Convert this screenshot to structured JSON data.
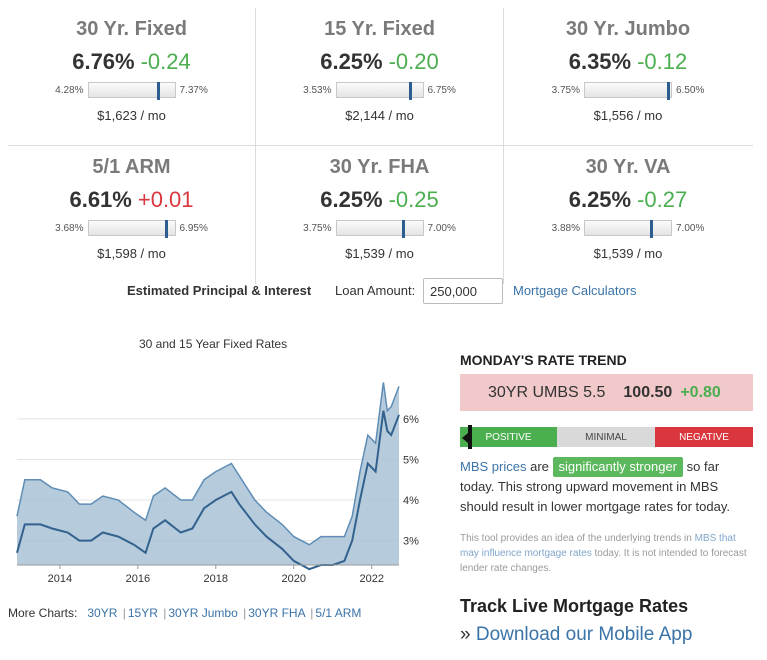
{
  "products": [
    {
      "name": "30 Yr. Fixed",
      "rate": "6.76%",
      "change": "-0.24",
      "dir": "down",
      "low": "4.28%",
      "high": "7.37%",
      "position": 0.8,
      "payment": "$1,623 / mo"
    },
    {
      "name": "15 Yr. Fixed",
      "rate": "6.25%",
      "change": "-0.20",
      "dir": "down",
      "low": "3.53%",
      "high": "6.75%",
      "position": 0.85,
      "payment": "$2,144 / mo"
    },
    {
      "name": "30 Yr. Jumbo",
      "rate": "6.35%",
      "change": "-0.12",
      "dir": "down",
      "low": "3.75%",
      "high": "6.50%",
      "position": 0.97,
      "payment": "$1,556 / mo"
    },
    {
      "name": "5/1 ARM",
      "rate": "6.61%",
      "change": "+0.01",
      "dir": "up",
      "low": "3.68%",
      "high": "6.95%",
      "position": 0.9,
      "payment": "$1,598 / mo"
    },
    {
      "name": "30 Yr. FHA",
      "rate": "6.25%",
      "change": "-0.25",
      "dir": "down",
      "low": "3.75%",
      "high": "7.00%",
      "position": 0.77,
      "payment": "$1,539 / mo"
    },
    {
      "name": "30 Yr. VA",
      "rate": "6.25%",
      "change": "-0.27",
      "dir": "down",
      "low": "3.88%",
      "high": "7.00%",
      "position": 0.76,
      "payment": "$1,539 / mo"
    }
  ],
  "calculator": {
    "label": "Estimated Principal & Interest",
    "loan_label": "Loan Amount:",
    "loan_value": "250,000",
    "link": "Mortgage Calculators"
  },
  "chart": {
    "title": "30 and 15 Year Fixed Rates"
  },
  "chart_data": {
    "type": "area",
    "title": "30 and 15 Year Fixed Rates",
    "x_ticks": [
      "2014",
      "2016",
      "2018",
      "2020",
      "2022"
    ],
    "y_ticks": [
      "3%",
      "4%",
      "5%",
      "6%"
    ],
    "ylim": [
      2.4,
      7.4
    ],
    "xlim": [
      2013.4,
      2023.2
    ],
    "series": [
      {
        "name": "",
        "color": "#a9c2d6",
        "points": [
          [
            2013.4,
            3.6
          ],
          [
            2013.6,
            4.5
          ],
          [
            2014.0,
            4.5
          ],
          [
            2014.3,
            4.3
          ],
          [
            2014.7,
            4.2
          ],
          [
            2015.0,
            3.9
          ],
          [
            2015.3,
            3.9
          ],
          [
            2015.6,
            4.1
          ],
          [
            2016.0,
            4.0
          ],
          [
            2016.4,
            3.7
          ],
          [
            2016.7,
            3.5
          ],
          [
            2016.9,
            4.1
          ],
          [
            2017.2,
            4.3
          ],
          [
            2017.6,
            4.0
          ],
          [
            2017.9,
            4.0
          ],
          [
            2018.2,
            4.5
          ],
          [
            2018.5,
            4.7
          ],
          [
            2018.9,
            4.9
          ],
          [
            2019.1,
            4.6
          ],
          [
            2019.5,
            4.0
          ],
          [
            2019.8,
            3.7
          ],
          [
            2020.2,
            3.4
          ],
          [
            2020.5,
            3.1
          ],
          [
            2020.9,
            2.9
          ],
          [
            2021.2,
            3.1
          ],
          [
            2021.5,
            3.1
          ],
          [
            2021.8,
            3.1
          ],
          [
            2022.0,
            3.6
          ],
          [
            2022.2,
            4.7
          ],
          [
            2022.4,
            5.6
          ],
          [
            2022.6,
            5.4
          ],
          [
            2022.8,
            6.9
          ],
          [
            2022.9,
            6.2
          ],
          [
            2023.0,
            6.3
          ],
          [
            2023.2,
            6.8
          ]
        ]
      },
      {
        "name": "",
        "color": "#33628f",
        "points": [
          [
            2013.4,
            2.7
          ],
          [
            2013.6,
            3.4
          ],
          [
            2014.0,
            3.4
          ],
          [
            2014.3,
            3.3
          ],
          [
            2014.7,
            3.2
          ],
          [
            2015.0,
            3.0
          ],
          [
            2015.3,
            3.0
          ],
          [
            2015.6,
            3.2
          ],
          [
            2016.0,
            3.1
          ],
          [
            2016.4,
            2.9
          ],
          [
            2016.7,
            2.7
          ],
          [
            2016.9,
            3.3
          ],
          [
            2017.2,
            3.5
          ],
          [
            2017.6,
            3.2
          ],
          [
            2017.9,
            3.3
          ],
          [
            2018.2,
            3.8
          ],
          [
            2018.5,
            4.0
          ],
          [
            2018.9,
            4.2
          ],
          [
            2019.1,
            3.9
          ],
          [
            2019.5,
            3.4
          ],
          [
            2019.8,
            3.1
          ],
          [
            2020.2,
            2.8
          ],
          [
            2020.5,
            2.5
          ],
          [
            2020.9,
            2.3
          ],
          [
            2021.2,
            2.4
          ],
          [
            2021.5,
            2.4
          ],
          [
            2021.8,
            2.5
          ],
          [
            2022.0,
            3.0
          ],
          [
            2022.2,
            4.0
          ],
          [
            2022.4,
            4.9
          ],
          [
            2022.6,
            4.7
          ],
          [
            2022.8,
            6.2
          ],
          [
            2022.9,
            5.7
          ],
          [
            2023.0,
            5.6
          ],
          [
            2023.2,
            6.1
          ]
        ]
      }
    ],
    "grid": true
  },
  "more_charts": {
    "label": "More Charts:",
    "links": [
      "30YR",
      "15YR",
      "30YR Jumbo",
      "30YR FHA",
      "5/1 ARM"
    ]
  },
  "trend": {
    "title": "MONDAY'S RATE TREND",
    "umbs_name": "30YR UMBS 5.5",
    "umbs_price": "100.50",
    "umbs_change": "+0.80",
    "meter": {
      "positive": "POSITIVE",
      "minimal": "MINIMAL",
      "negative": "NEGATIVE"
    },
    "desc_link": "MBS prices",
    "desc_are": "are",
    "desc_pill": "significantly stronger",
    "desc_rest": "so far today. This strong upward movement in MBS should result in lower mortgage rates for today.",
    "fine_a": "This tool provides an idea of the underlying trends in",
    "fine_link": "MBS that may influence mortgage rates",
    "fine_b": "today. It is not intended to forecast lender rate changes."
  },
  "track": {
    "title": "Track Live Mortgage Rates",
    "prefix": "»",
    "link": "Download our Mobile App"
  }
}
